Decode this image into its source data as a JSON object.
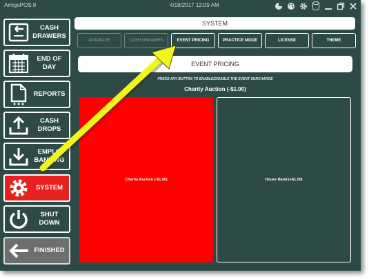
{
  "window": {
    "app_title": "AmigoPOS 8",
    "datetime": "4/18/2017 12:09 AM",
    "title_icons": [
      "pie-chart-icon",
      "palette-icon",
      "gear-icon",
      "database-icon",
      "minimize-icon",
      "restore-icon",
      "close-icon"
    ]
  },
  "sidebar": {
    "items": [
      {
        "label_line1": "CASH",
        "label_line2": "DRAWERS",
        "icon": "cash-drawer-icon"
      },
      {
        "label_line1": "END OF",
        "label_line2": "DAY",
        "icon": "calendar-icon"
      },
      {
        "label_line1": "REPORTS",
        "label_line2": "",
        "icon": "report-icon"
      },
      {
        "label_line1": "CASH",
        "label_line2": "DROPS",
        "icon": "upload-tray-icon"
      },
      {
        "label_line1": "EMPLO",
        "label_line2": "BANKING",
        "icon": "download-tray-icon"
      },
      {
        "label_line1": "SYSTEM",
        "label_line2": "",
        "icon": "gear-icon",
        "active": true
      },
      {
        "label_line1": "SHUT",
        "label_line2": "DOWN",
        "icon": "power-icon"
      },
      {
        "label_line1": "FINISHED",
        "label_line2": "",
        "icon": "back-arrow-icon"
      }
    ]
  },
  "main": {
    "header": "SYSTEM",
    "tabs": [
      {
        "label": "DATABASE",
        "enabled": false
      },
      {
        "label": "CASH DRAWERS",
        "enabled": false
      },
      {
        "label": "EVENT PRICING",
        "enabled": true
      },
      {
        "label": "PRACTICE MODE",
        "enabled": true
      },
      {
        "label": "LICENSE",
        "enabled": true
      },
      {
        "label": "THEME",
        "enabled": true
      }
    ],
    "section_title": "EVENT PRICING",
    "hint": "PRESS ANY BUTTON TO ENABLE/DISABLE THE EVENT SURCHARGE",
    "current_surcharge": "Charity Auction (-$1.00)",
    "charges": [
      {
        "label": "Charity Auction (-$1.00)",
        "enabled": true
      },
      {
        "label": "House Band (+$1.00)",
        "enabled": false
      }
    ]
  },
  "colors": {
    "background": "#2e4a47",
    "active": "#e8201e",
    "enabled_charge": "#ff0000",
    "annotation_arrow": "#f2f51a"
  }
}
